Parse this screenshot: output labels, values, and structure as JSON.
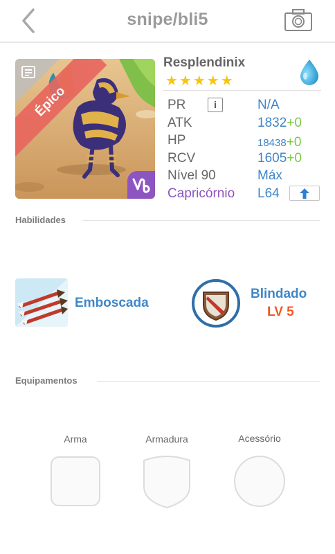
{
  "header": {
    "title": "snipe/bli5",
    "back_icon": "chevron-left-icon",
    "camera_icon": "camera-icon"
  },
  "monster": {
    "rarity": "Épico",
    "name": "Resplendinix",
    "stars": "★★★★★",
    "star_count": 5,
    "element_icon": "water-drop-icon",
    "zodiac_icon": "capricorn-icon"
  },
  "stats": {
    "pr": {
      "label": "PR",
      "value": "N/A"
    },
    "atk": {
      "label": "ATK",
      "value": "1832",
      "bonus": "+0"
    },
    "hp": {
      "label": "HP",
      "value": "18438",
      "bonus": "+0"
    },
    "rcv": {
      "label": "RCV",
      "value": "1605",
      "bonus": "+0"
    },
    "level": {
      "label": "Nível 90",
      "value": "Máx"
    },
    "sign": {
      "label": "Capricórnio",
      "value": "L64"
    }
  },
  "abilities": {
    "section_title": "Habilidades",
    "active": {
      "name": "Emboscada",
      "icon": "arrows-icon"
    },
    "passive": {
      "name": "Blindado",
      "level": "LV 5",
      "icon": "shield-icon"
    }
  },
  "equipment": {
    "section_title": "Equipamentos",
    "slots": [
      {
        "label": "Arma"
      },
      {
        "label": "Armadura"
      },
      {
        "label": "Acessório"
      }
    ]
  },
  "colors": {
    "accent_blue": "#3f86c9",
    "bonus_green": "#7ac943",
    "zodiac_purple": "#8d55c2",
    "level_orange": "#f05a24",
    "rarity_red": "#e8675f",
    "star_gold": "#f5c518"
  }
}
